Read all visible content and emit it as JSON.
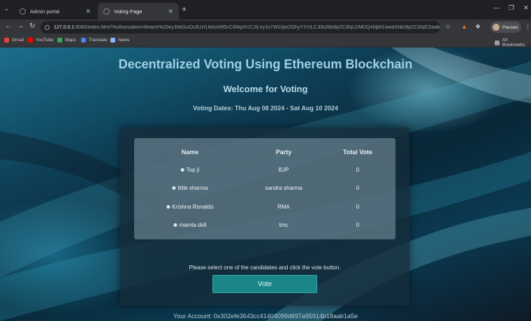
{
  "browser": {
    "tabs": [
      {
        "title": "Admin portal"
      },
      {
        "title": "Voting Page"
      }
    ],
    "address": {
      "host": "127.0.0.1",
      "path": ":8080/index.html?Authorization=Bearer%20eyJhbGciOiJIUzI1NiIsInR5cCI6IkpXVCJ9.eyJuYW1lIjoiZGhyYXYiLCJ0b2tlbl9pZCI6IjU2MDQ4MjM1IiwidXNlcl9pZCI6IjE2IiwibmJmIjoxNzIzMDk..."
    },
    "profile_label": "Paused",
    "bookmarks": [
      {
        "label": "Gmail",
        "color": "#ea4335"
      },
      {
        "label": "YouTube",
        "color": "#ff0000"
      },
      {
        "label": "Maps",
        "color": "#34a853"
      },
      {
        "label": "Translate",
        "color": "#4285f4"
      },
      {
        "label": "News",
        "color": "#8ab4f8"
      }
    ],
    "all_bookmarks": "All Bookmarks"
  },
  "page": {
    "title": "Decentralized Voting Using Ethereum Blockchain",
    "subtitle": "Welcome for Voting",
    "voting_dates": "Voting Dates: Thu Aug 08 2024 - Sat Aug 10 2024",
    "table": {
      "headers": [
        "Name",
        "Party",
        "Total Vote"
      ],
      "rows": [
        {
          "name": "Top ji",
          "party": "BJP",
          "votes": "0"
        },
        {
          "name": "little sharma",
          "party": "sandra sharma",
          "votes": "0"
        },
        {
          "name": "Krishna Ronaldo",
          "party": "RMA",
          "votes": "0"
        },
        {
          "name": "mamta didi",
          "party": "tmc",
          "votes": "0"
        }
      ]
    },
    "hint": "Please select one of the candidates and click the vote button.",
    "vote_label": "Vote",
    "account": "Your Account: 0x302efe3643cc41404099d697a95914b18aab1a5e"
  },
  "colors": {
    "accent": "#1a8688",
    "title": "#9fd2e6"
  }
}
